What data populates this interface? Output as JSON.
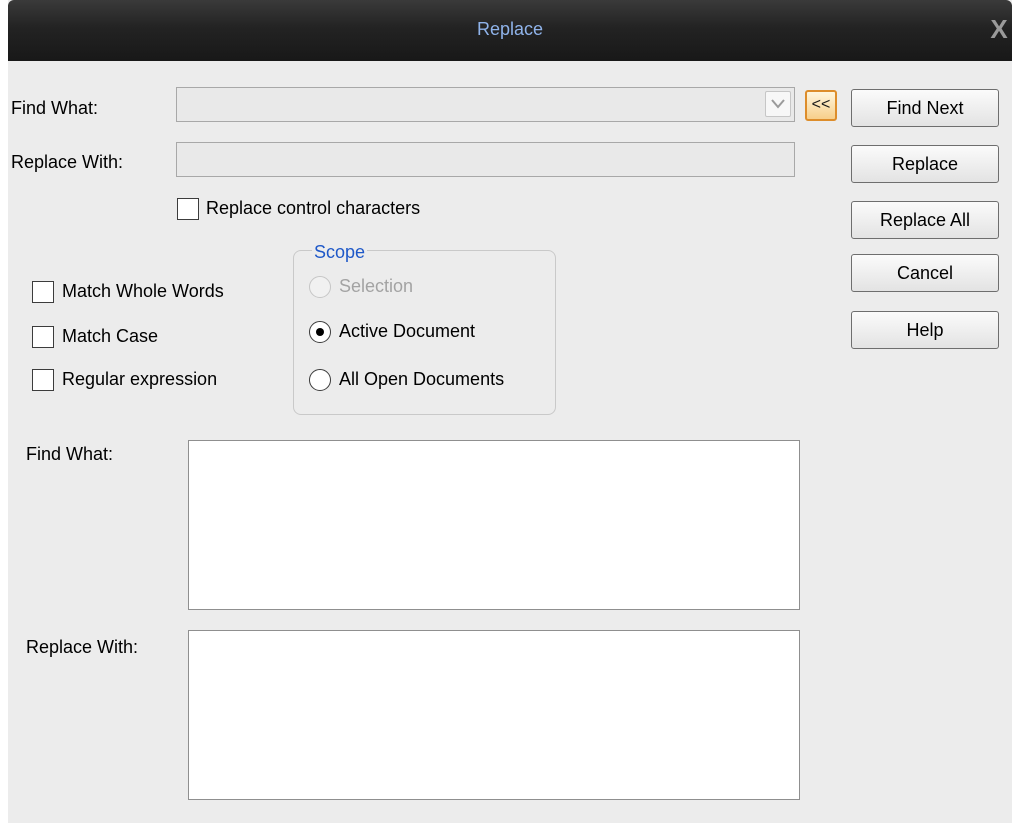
{
  "window": {
    "title": "Replace",
    "close_glyph": "X"
  },
  "search": {
    "find_label": "Find What:",
    "find_value": "",
    "replace_label": "Replace With:",
    "replace_value": "",
    "collapse_button": "<<"
  },
  "options": {
    "replace_control_chars": "Replace control characters",
    "match_whole_words": "Match Whole Words",
    "match_case": "Match Case",
    "regular_expression": "Regular expression"
  },
  "scope": {
    "title": "Scope",
    "selection": "Selection",
    "active_document": "Active Document",
    "all_open_documents": "All Open Documents",
    "selected": "active_document"
  },
  "buttons": {
    "find_next": "Find Next",
    "replace": "Replace",
    "replace_all": "Replace All",
    "cancel": "Cancel",
    "help": "Help"
  },
  "lower": {
    "find_label": "Find What:",
    "replace_label": "Replace With:",
    "find_text": "",
    "replace_text": ""
  },
  "colors": {
    "title_text": "#8fb3ea",
    "scope_title": "#1e58c8",
    "collapse_button_border": "#dd8d2b",
    "dialog_background": "#ececec"
  }
}
